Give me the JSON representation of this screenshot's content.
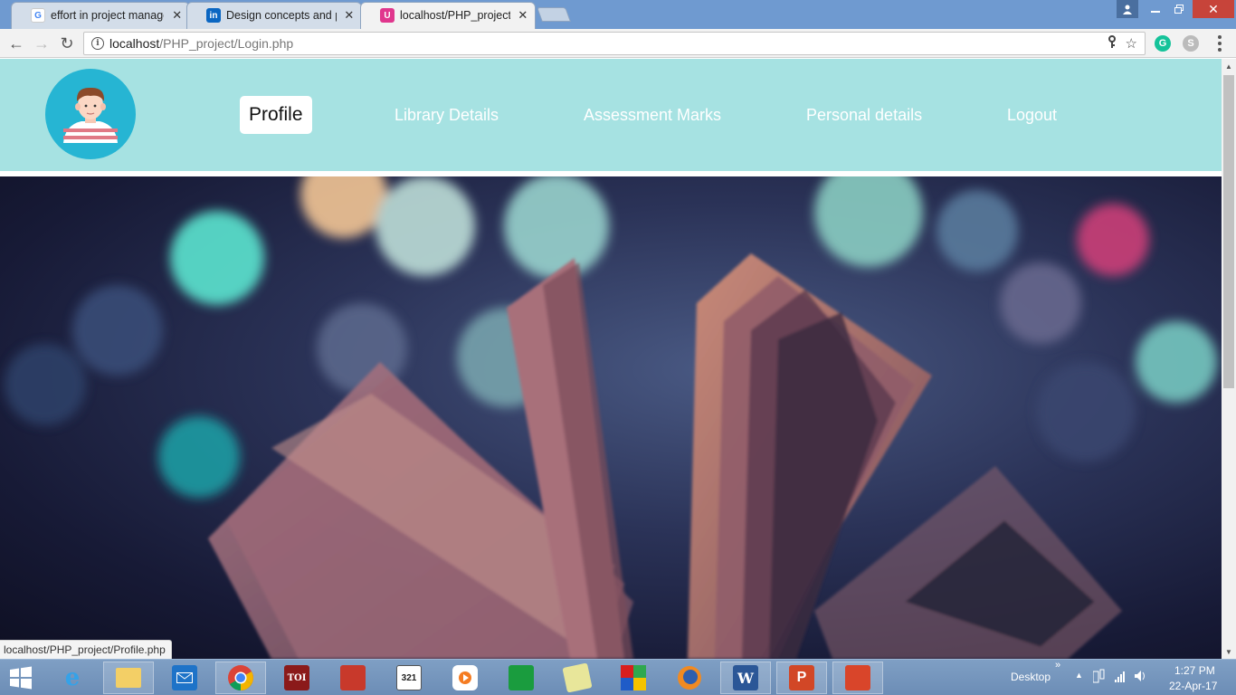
{
  "browser": {
    "tabs": [
      {
        "title": "effort in project manage",
        "favicon": "google-icon",
        "active": false
      },
      {
        "title": "Design concepts and pri",
        "favicon": "linkedin-icon",
        "active": false
      },
      {
        "title": "localhost/PHP_project/Lo",
        "favicon": "site-icon",
        "active": true
      }
    ],
    "address": {
      "host": "localhost",
      "path": "/PHP_project/Login.php"
    },
    "status_url": "localhost/PHP_project/Profile.php"
  },
  "site": {
    "logo": "avatar-icon",
    "nav": [
      {
        "label": "Profile",
        "active": true
      },
      {
        "label": "Library Details",
        "active": false
      },
      {
        "label": "Assessment Marks",
        "active": false
      },
      {
        "label": "Personal details",
        "active": false
      },
      {
        "label": "Logout",
        "active": false
      }
    ],
    "header_color": "#a6e2e2",
    "hero_image": "open-book-bokeh-photo"
  },
  "taskbar": {
    "desktop_label": "Desktop",
    "clock_time": "1:27 PM",
    "clock_date": "22-Apr-17",
    "apps": [
      "internet-explorer-icon",
      "file-explorer-icon",
      "mail-icon",
      "chrome-icon",
      "toi-icon",
      "presentation-icon",
      "calendar-321-icon",
      "media-player-icon",
      "store-icon",
      "notes-icon",
      "colors-icon",
      "firefox-icon",
      "word-icon",
      "powerpoint-icon",
      "acrobat-icon"
    ],
    "toi_label": "TOI",
    "cal_label": "321",
    "word_label": "W",
    "ppt_label": "P"
  }
}
